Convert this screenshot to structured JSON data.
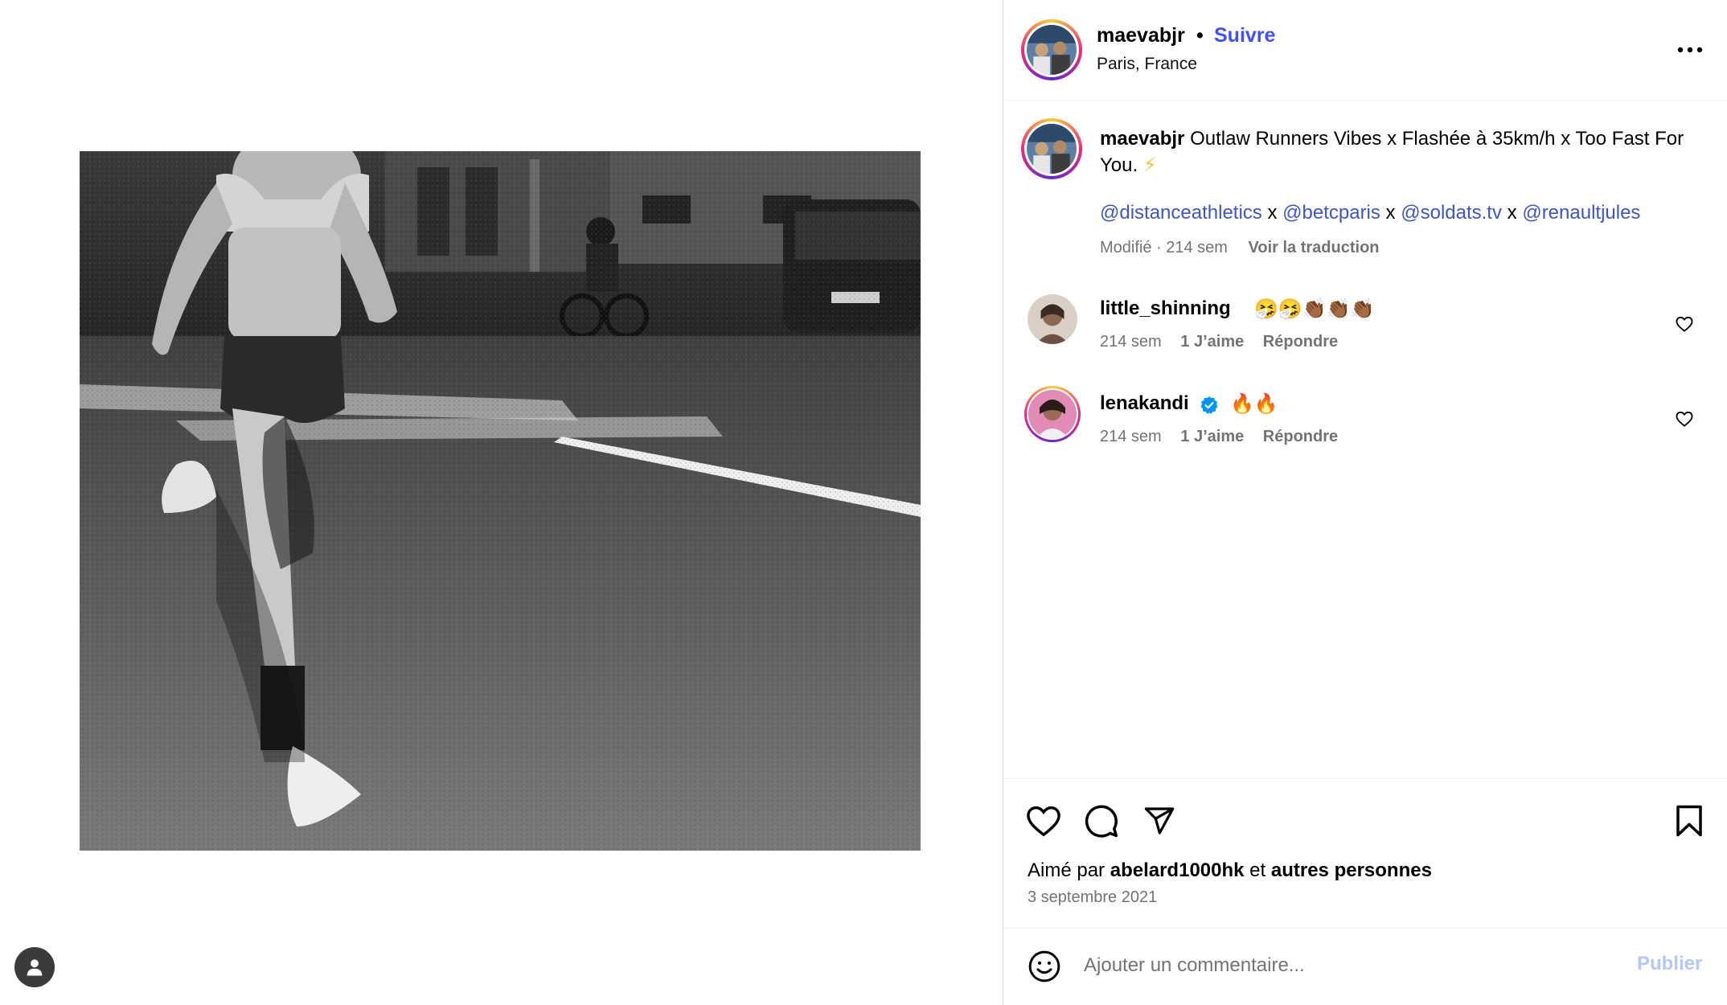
{
  "post": {
    "image_icon": "running-photo",
    "author": {
      "username": "maevabjr",
      "separator": "•",
      "follow_label": "Suivre",
      "location": "Paris, France"
    },
    "more_icon": "more-horizontal-icon",
    "caption": {
      "username": "maevabjr",
      "text": "Outlaw Runners Vibes x Flashée à 35km/h x Too Fast For You.",
      "emoji": "⚡",
      "mentions": [
        {
          "handle": "@distanceathletics",
          "sep": " x "
        },
        {
          "handle": "@betcparis",
          "sep": " x "
        },
        {
          "handle": "@soldats.tv",
          "sep": " x "
        },
        {
          "handle": "@renaultjules",
          "sep": ""
        }
      ],
      "edited_label": "Modifié · 214 sem",
      "translate_label": "Voir la traduction"
    },
    "comments": [
      {
        "author": "little_shinning",
        "text": "🤧🤧👏🏾👏🏾👏🏾",
        "time": "214 sem",
        "likes": "1 J’aime",
        "reply": "Répondre",
        "verified": false
      },
      {
        "author": "lenakandi",
        "text": "🔥🔥",
        "time": "214 sem",
        "likes": "1 J’aime",
        "reply": "Répondre",
        "verified": true
      }
    ],
    "actions": {
      "like_icon": "heart-icon",
      "comment_icon": "comment-icon",
      "share_icon": "send-icon",
      "save_icon": "bookmark-icon"
    },
    "likes_line": {
      "prefix": "Aimé par",
      "user": "abelard1000hk",
      "conj": "et",
      "others": "autres personnes"
    },
    "date": "3 septembre 2021",
    "composer": {
      "placeholder": "Ajouter un commentaire...",
      "publish_label": "Publier"
    }
  },
  "colors": {
    "link": "#4150f7",
    "mention": "#3d56c7",
    "muted": "#737373",
    "publish_disabled": "#b3c8f6",
    "verified": "#0095f6"
  }
}
